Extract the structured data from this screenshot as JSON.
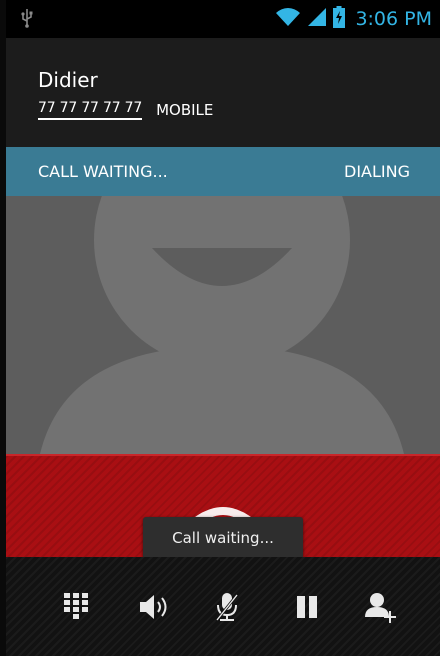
{
  "status_bar": {
    "time": "3:06 PM",
    "icons": [
      "usb-icon",
      "wifi-icon",
      "signal-icon",
      "battery-charging-icon"
    ],
    "accent_color": "#33b5e5"
  },
  "caller": {
    "name": "Didier",
    "number": "77 77 77 77 77",
    "number_type": "MOBILE"
  },
  "call_status": {
    "left": "CALL WAITING...",
    "right": "DIALING",
    "bar_color": "#3a7b94"
  },
  "contact_photo": {
    "icon": "default-contact-silhouette"
  },
  "end_call": {
    "icon": "end-call-icon",
    "panel_color": "#a90f13"
  },
  "toast": {
    "text": "Call waiting..."
  },
  "controls": [
    {
      "icon": "dialpad-icon"
    },
    {
      "icon": "speaker-icon"
    },
    {
      "icon": "mute-mic-icon"
    },
    {
      "icon": "hold-icon"
    },
    {
      "icon": "add-call-icon"
    }
  ]
}
